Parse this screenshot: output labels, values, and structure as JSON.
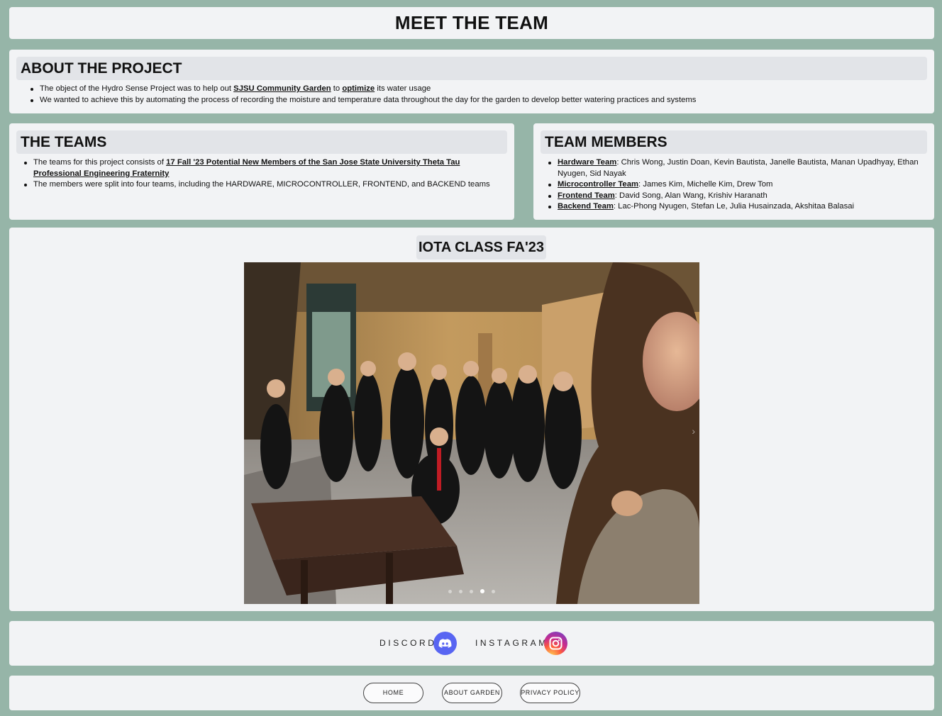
{
  "header": {
    "title": "MEET THE TEAM"
  },
  "about": {
    "title": "ABOUT THE PROJECT",
    "line1_pre": "The object of the Hydro Sense Project was to help out ",
    "line1_link1": "SJSU Community Garden",
    "line1_mid": " to ",
    "line1_link2": "optimize",
    "line1_post": " its water usage",
    "line2": "We wanted to achieve this by automating the process of recording the moisture and temperature data throughout the day for the garden to develop better watering practices and systems"
  },
  "teams": {
    "title": "THE TEAMS",
    "line1_pre": "The teams for this project consists of ",
    "line1_link": "17 Fall '23 Potential New Members of the San Jose State University Theta Tau Professional Engineering Fraternity",
    "line2": "The members were split into four teams, including the HARDWARE, MICROCONTROLLER, FRONTEND, and BACKEND teams"
  },
  "members": {
    "title": "TEAM MEMBERS",
    "groups": [
      {
        "team": "Hardware Team",
        "names": ": Chris Wong, Justin Doan, Kevin Bautista, Janelle Bautista, Manan Upadhyay, Ethan Nyugen, Sid Nayak"
      },
      {
        "team": "Microcontroller Team",
        "names": ": James Kim, Michelle Kim, Drew Tom"
      },
      {
        "team": "Frontend Team",
        "names": ": David Song, Alan Wang, Krishiv Haranath"
      },
      {
        "team": "Backend Team",
        "names": ": Lac-Phong Nyugen, Stefan Le, Julia Husainzada, Akshitaa Balasai"
      }
    ]
  },
  "gallery": {
    "title": "IOTA CLASS FA'23",
    "slide_count": 5,
    "active_slide": 4,
    "next_arrow": "›"
  },
  "social": {
    "discord_label": "DISCORD",
    "instagram_label": "INSTAGRAM"
  },
  "footer": {
    "home": "HOME",
    "about_garden": "ABOUT GARDEN",
    "privacy": "PRIVACY POLICY"
  }
}
